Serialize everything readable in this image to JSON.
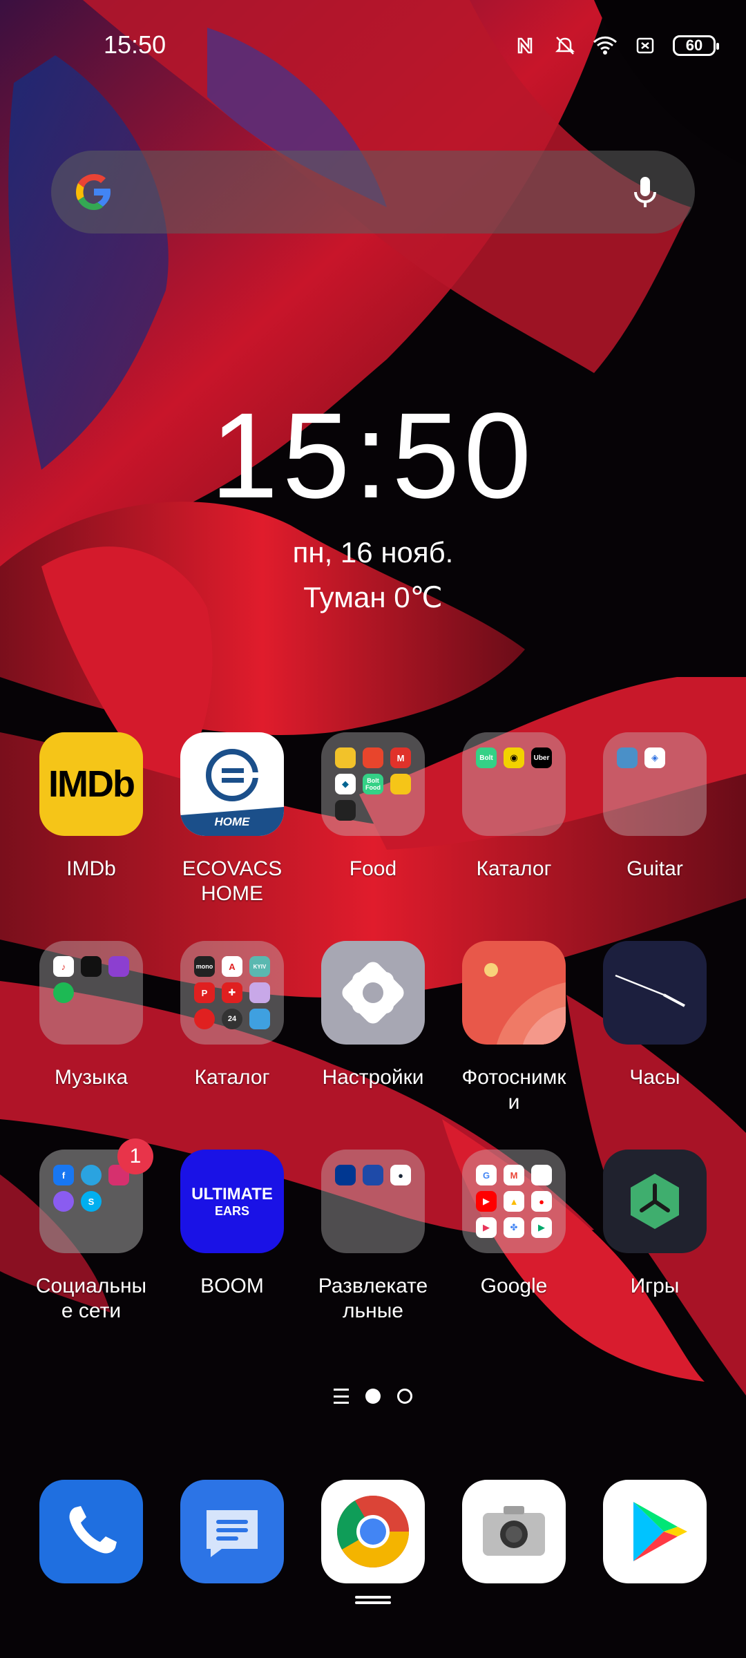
{
  "status_bar": {
    "time": "15:50",
    "battery": "60",
    "icons": [
      "nfc-icon",
      "mute-icon",
      "wifi-icon",
      "sim-icon",
      "battery-icon"
    ]
  },
  "search": {
    "icons": [
      "google-icon",
      "mic-icon"
    ]
  },
  "clock": {
    "time": "15:50",
    "date": "пн, 16 нояб.",
    "weather": "Туман 0℃"
  },
  "apps": [
    {
      "label": "IMDb",
      "icon_text": "IMDb"
    },
    {
      "label": "ECOVACS\nHOME",
      "icon_text": "HOME"
    },
    {
      "label": "Food"
    },
    {
      "label": "Каталог"
    },
    {
      "label": "Guitar"
    },
    {
      "label": "Музыка"
    },
    {
      "label": "Каталог"
    },
    {
      "label": "Настройки"
    },
    {
      "label": "Фотоснимк\nи"
    },
    {
      "label": "Часы"
    },
    {
      "label": "Социальны\nе сети",
      "badge": "1"
    },
    {
      "label": "BOOM",
      "icon_text_1": "ULTIMATE",
      "icon_text_2": "EARS"
    },
    {
      "label": "Развлекате\nльные"
    },
    {
      "label": "Google"
    },
    {
      "label": "Игры"
    }
  ],
  "folder_minis": {
    "food": [
      "Bolt Food"
    ],
    "catalog1": [
      "Bolt",
      "Uber"
    ],
    "catalog2": [
      "mono",
      "А",
      "KYIV",
      "P",
      "24"
    ]
  },
  "dock": [
    "phone-icon",
    "messages-icon",
    "chrome-icon",
    "camera-icon",
    "play-store-icon"
  ],
  "colors": {
    "imdb": "#f5c518",
    "boom": "#1a12e6",
    "badge": "#e8344a",
    "phone": "#1f6fe0"
  }
}
